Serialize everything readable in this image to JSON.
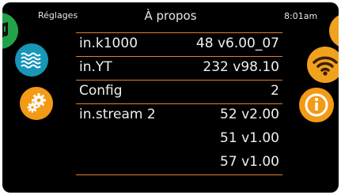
{
  "header": {
    "left_label": "Réglages",
    "title": "À propos",
    "time": "8:01am"
  },
  "icons": {
    "left": [
      "music-icon",
      "water-waves-icon",
      "settings-gears-icon"
    ],
    "right": [
      "partial-icon",
      "wifi-icon",
      "info-icon"
    ]
  },
  "colors": {
    "background": "#000000",
    "accent_orange": "#f39a16",
    "divider": "#e0802a",
    "green": "#22a34a",
    "blue": "#1796b8",
    "text": "#f0f0f0"
  },
  "rows": [
    {
      "label": "in.k1000",
      "value": "48 v6.00_07"
    },
    {
      "label": "in.YT",
      "value": "232 v98.10"
    },
    {
      "label": "Config",
      "value": "2"
    },
    {
      "label": "in.stream 2",
      "value": "52 v2.00"
    },
    {
      "label": "",
      "value": "51 v1.00"
    },
    {
      "label": "",
      "value": "57 v1.00"
    }
  ]
}
